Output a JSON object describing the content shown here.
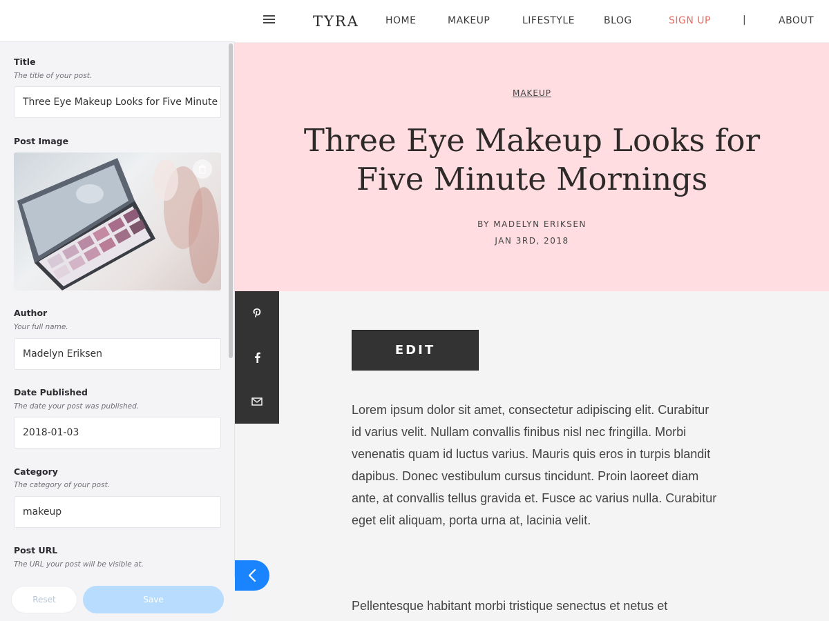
{
  "editor": {
    "fields": [
      {
        "label": "Title",
        "help": "The title of your post.",
        "value": "Three Eye Makeup Looks for Five Minute Mornings"
      },
      {
        "label": "Post Image"
      },
      {
        "label": "Author",
        "help": "Your full name.",
        "value": "Madelyn Eriksen"
      },
      {
        "label": "Date Published",
        "help": "The date your post was published.",
        "value": "2018-01-03"
      },
      {
        "label": "Category",
        "help": "The category of your post.",
        "value": "makeup"
      },
      {
        "label": "Post URL",
        "help": "The URL your post will be visible at."
      }
    ],
    "reset_label": "Reset",
    "save_label": "Save"
  },
  "site": {
    "brand": "TYRA",
    "nav": [
      "HOME",
      "MAKEUP",
      "LIFESTYLE",
      "BLOG",
      "SIGN UP",
      "|",
      "ABOUT"
    ],
    "hero": {
      "category": "MAKEUP",
      "title": "Three Eye Makeup Looks for Five Minute Mornings",
      "byline": "BY MADELYN ERIKSEN",
      "date": "JAN 3RD, 2018"
    },
    "share_icons": [
      "pinterest-icon",
      "facebook-icon",
      "mail-icon"
    ],
    "edit_label": "EDIT",
    "paragraphs": [
      "Lorem ipsum dolor sit amet, consectetur adipiscing elit. Curabitur id varius velit. Nullam convallis finibus nisl nec fringilla. Morbi venenatis quam id luctus varius. Mauris quis eros in turpis blandit dapibus. Donec vestibulum cursus tincidunt. Proin laoreet diam ante, at convallis tellus gravida et. Fusce ac varius nulla. Curabitur eget elit aliquam, porta urna at, lacinia velit.",
      "Pellentesque habitant morbi tristique senectus et netus et"
    ]
  },
  "colors": {
    "accent": "#1a84ff",
    "hero_bg": "#ffdde0",
    "signup": "#ea6a5f",
    "save_btn": "#b7dcfe"
  }
}
